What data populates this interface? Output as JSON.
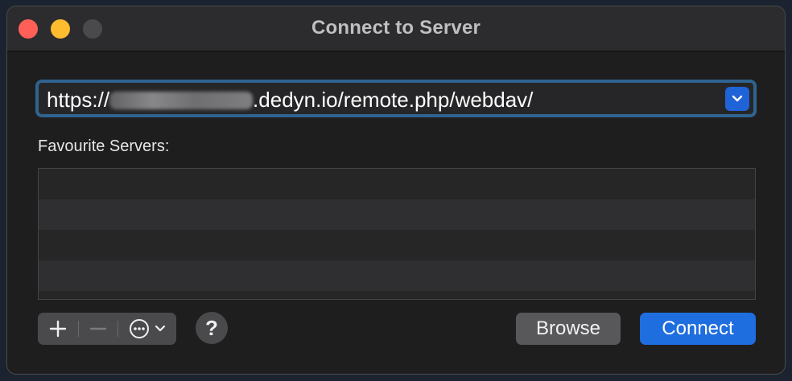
{
  "window": {
    "title": "Connect to Server"
  },
  "address": {
    "prefix": "https://",
    "suffix": ".dedyn.io/remote.php/webdav/"
  },
  "favourites": {
    "label": "Favourite Servers:",
    "rows": 4
  },
  "toolbar": {
    "add_icon": "plus-icon",
    "remove_icon": "minus-icon",
    "more_icon": "ellipsis-circle-icon",
    "help_label": "?",
    "browse_label": "Browse",
    "connect_label": "Connect"
  },
  "colors": {
    "accent": "#1f6ee0",
    "focus_ring": "#2f6390"
  }
}
